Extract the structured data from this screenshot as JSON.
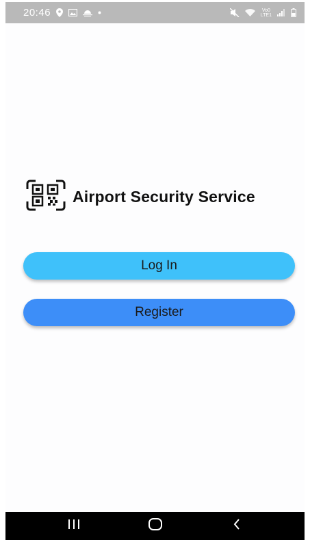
{
  "status_bar": {
    "time": "20:46",
    "network_label_top": "Vo0",
    "network_label_bottom": "LTE1",
    "left_icons": [
      "location-pin-icon",
      "image-icon",
      "weather-icon",
      "dot-icon"
    ],
    "right_icons": [
      "mute-icon",
      "wifi-icon",
      "signal-icon",
      "battery-icon"
    ]
  },
  "brand": {
    "logo": "qr-code-icon",
    "title": "Airport Security Service"
  },
  "actions": {
    "login_label": "Log In",
    "register_label": "Register"
  },
  "nav_bar": {
    "recents_icon": "recents-icon",
    "home_icon": "home-icon",
    "back_icon": "back-icon"
  },
  "colors": {
    "login_button": "#3fc1fa",
    "register_button": "#3d8ef8",
    "status_bar": "#b9b9b9",
    "nav_bar": "#000000"
  }
}
